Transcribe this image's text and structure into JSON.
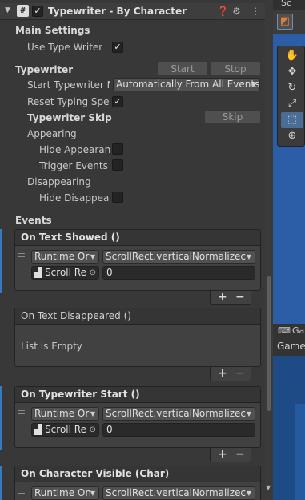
{
  "component": {
    "title": "Typewriter - By Character",
    "enabled_mark": "✓",
    "script_glyph": "#",
    "help_icon": "help-icon",
    "presets_icon": "presets-icon",
    "menu_icon": "context-menu-icon"
  },
  "main_settings": {
    "heading": "Main Settings",
    "use_type_writer_label": "Use Type Writer",
    "use_type_writer_checked": "✓"
  },
  "typewriter": {
    "heading": "Typewriter",
    "start_button": "Start",
    "stop_button": "Stop",
    "start_mode_label": "Start Typewriter M",
    "start_mode_value": "Automatically From All Events",
    "reset_speed_label": "Reset Typing Spee",
    "reset_speed_checked": "✓"
  },
  "typewriter_skip": {
    "heading": "Typewriter Skip",
    "skip_button": "Skip",
    "appearing_label": "Appearing",
    "hide_appearance_label": "Hide Appearanc",
    "trigger_events_label": "Trigger Events C",
    "disappearing_label": "Disappearing",
    "hide_disappearance_label": "Hide Disappeara"
  },
  "events": {
    "heading": "Events",
    "list": [
      {
        "title": "On Text Showed ()",
        "runtime": "Runtime Or",
        "function": "ScrollRect.verticalNormalizec",
        "object": "Scroll Re",
        "value": "0",
        "plus": "+",
        "minus": "−"
      },
      {
        "title": "On Text Disappeared ()",
        "empty_text": "List is Empty",
        "plus": "+",
        "minus": "−"
      },
      {
        "title": "On Typewriter Start ()",
        "runtime": "Runtime Or",
        "function": "ScrollRect.verticalNormalizec",
        "object": "Scroll Re",
        "value": "0",
        "plus": "+",
        "minus": "−"
      },
      {
        "title": "On Character Visible (Char)",
        "runtime": "Runtime On",
        "function": "ScrollRect.verticalNormalizec"
      }
    ]
  },
  "scene": {
    "tab_label": "Sc",
    "game_tab_short": "Ga",
    "game_label": "Game",
    "tools": [
      "hand-tool-icon",
      "move-tool-icon",
      "rotate-tool-icon",
      "scale-tool-icon",
      "rect-tool-icon",
      "transform-tool-icon"
    ]
  },
  "colors": {
    "accent_blue": "#3a79bb",
    "panel_bg": "#383838",
    "scene_blue": "#2c5ea8"
  }
}
